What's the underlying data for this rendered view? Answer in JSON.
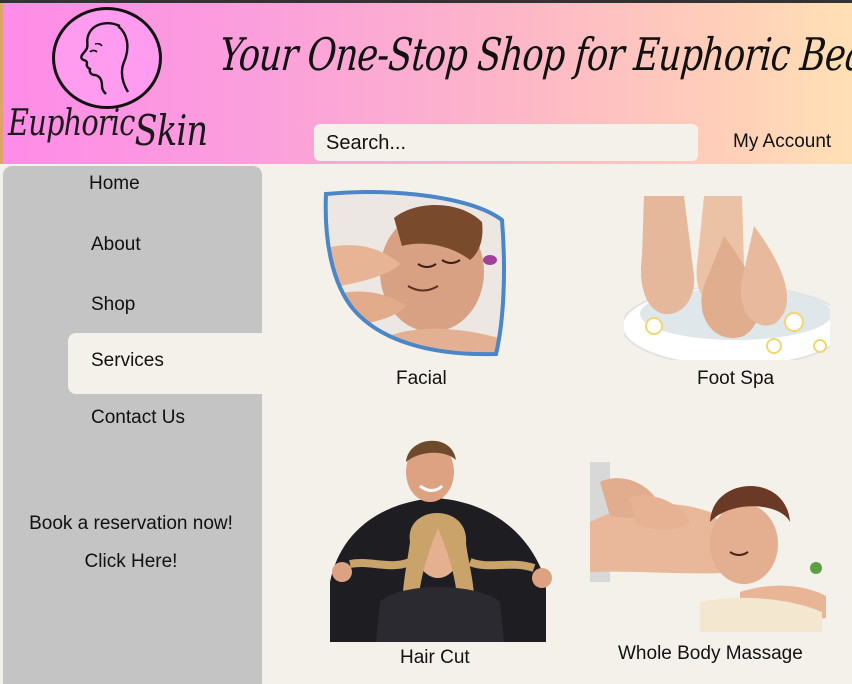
{
  "header": {
    "logo": {
      "word1": "Euphoric",
      "word2": "Skin",
      "icon": "woman-face-profile-icon"
    },
    "tagline": "Your One-Stop Shop for Euphoric Beauty",
    "search_placeholder": "Search...",
    "account_label": "My Account"
  },
  "sidebar": {
    "items": [
      {
        "label": "Home"
      },
      {
        "label": "About"
      },
      {
        "label": "Shop"
      },
      {
        "label": "Services",
        "active": true
      },
      {
        "label": "Contact Us"
      }
    ],
    "booking": {
      "line1": "Book a reservation now!",
      "line2": "Click Here!"
    }
  },
  "services": [
    {
      "label": "Facial",
      "image": "facial-massage-photo"
    },
    {
      "label": "Foot Spa",
      "image": "foot-spa-photo"
    },
    {
      "label": "Hair Cut",
      "image": "hair-cut-photo"
    },
    {
      "label": "Whole Body Massage",
      "image": "body-massage-photo"
    }
  ],
  "colors": {
    "header_gradient_start": "#ff8be8",
    "header_gradient_end": "#ffe0b6",
    "sidebar": "#c4c4c4",
    "background": "#f4f1ea",
    "facial_frame": "#4a86c8"
  }
}
